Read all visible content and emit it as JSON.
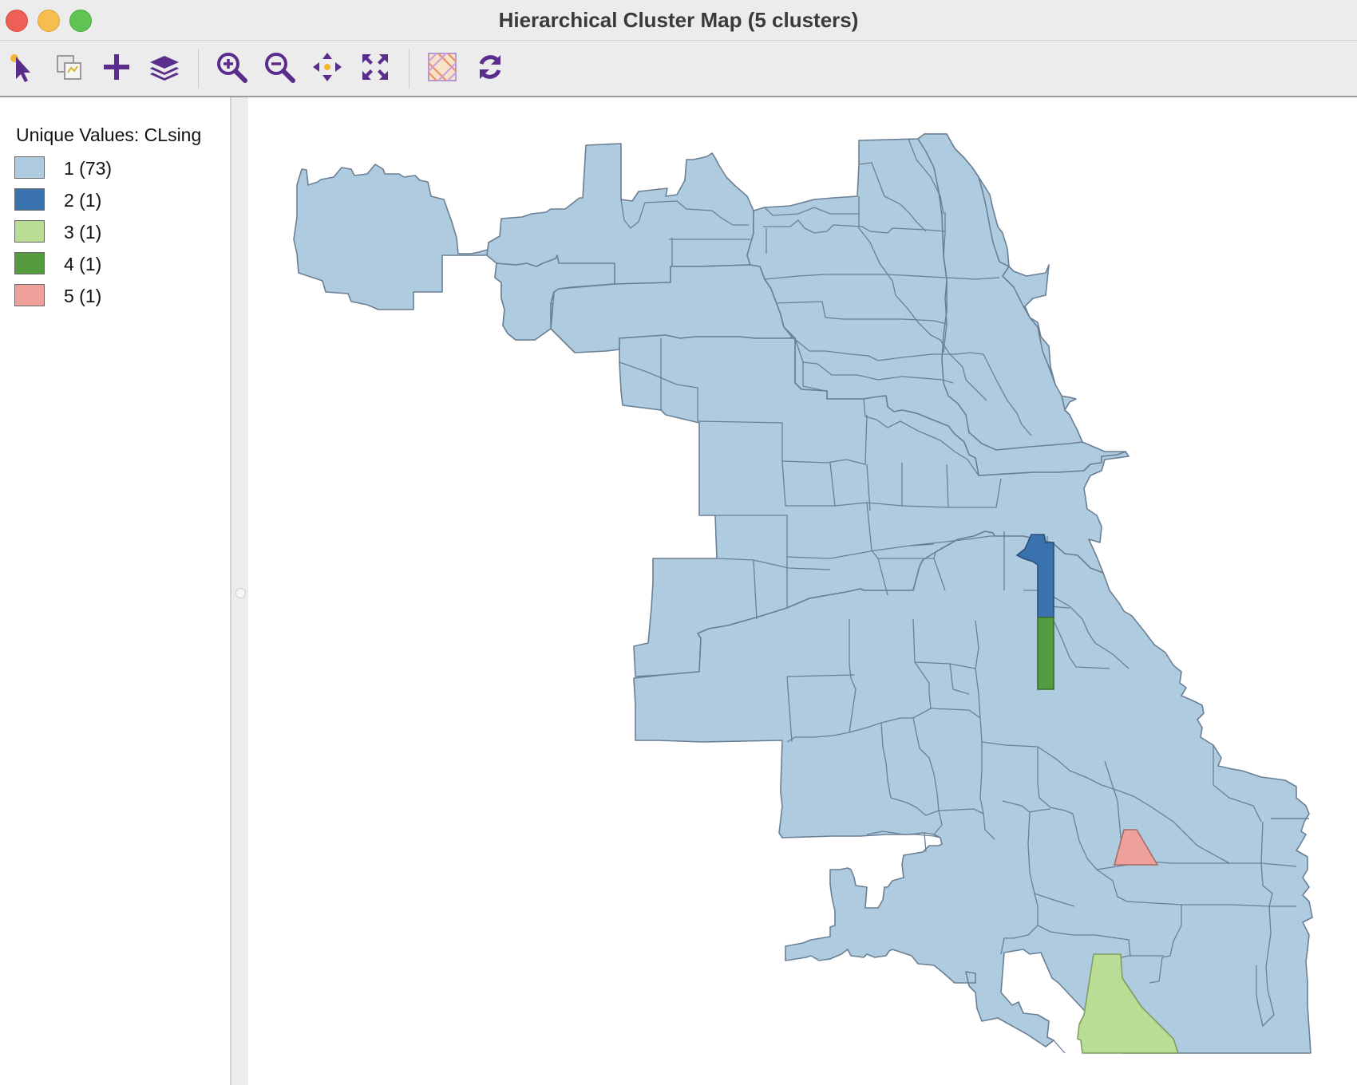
{
  "window": {
    "title": "Hierarchical Cluster Map (5 clusters)"
  },
  "toolbar": {
    "tools": [
      {
        "icon": "select-arrow-icon"
      },
      {
        "icon": "copy-icon"
      },
      {
        "icon": "plus-icon"
      },
      {
        "icon": "layers-icon"
      },
      {
        "icon": "zoom-in-icon"
      },
      {
        "icon": "zoom-out-icon"
      },
      {
        "icon": "pan-icon"
      },
      {
        "icon": "full-extent-icon"
      },
      {
        "icon": "basemap-icon"
      },
      {
        "icon": "refresh-icon"
      }
    ]
  },
  "legend": {
    "title": "Unique Values: CLsing",
    "items": [
      {
        "label": "1 (73)",
        "color": "#aecbe0"
      },
      {
        "label": "2 (1)",
        "color": "#3a72ad"
      },
      {
        "label": "3 (1)",
        "color": "#badd95"
      },
      {
        "label": "4 (1)",
        "color": "#549c3f"
      },
      {
        "label": "5 (1)",
        "color": "#eea19b"
      }
    ]
  },
  "map": {
    "variable": "CLsing",
    "outline_color": "#6b7f94",
    "cluster_counts": [
      73,
      1,
      1,
      1,
      1
    ]
  }
}
